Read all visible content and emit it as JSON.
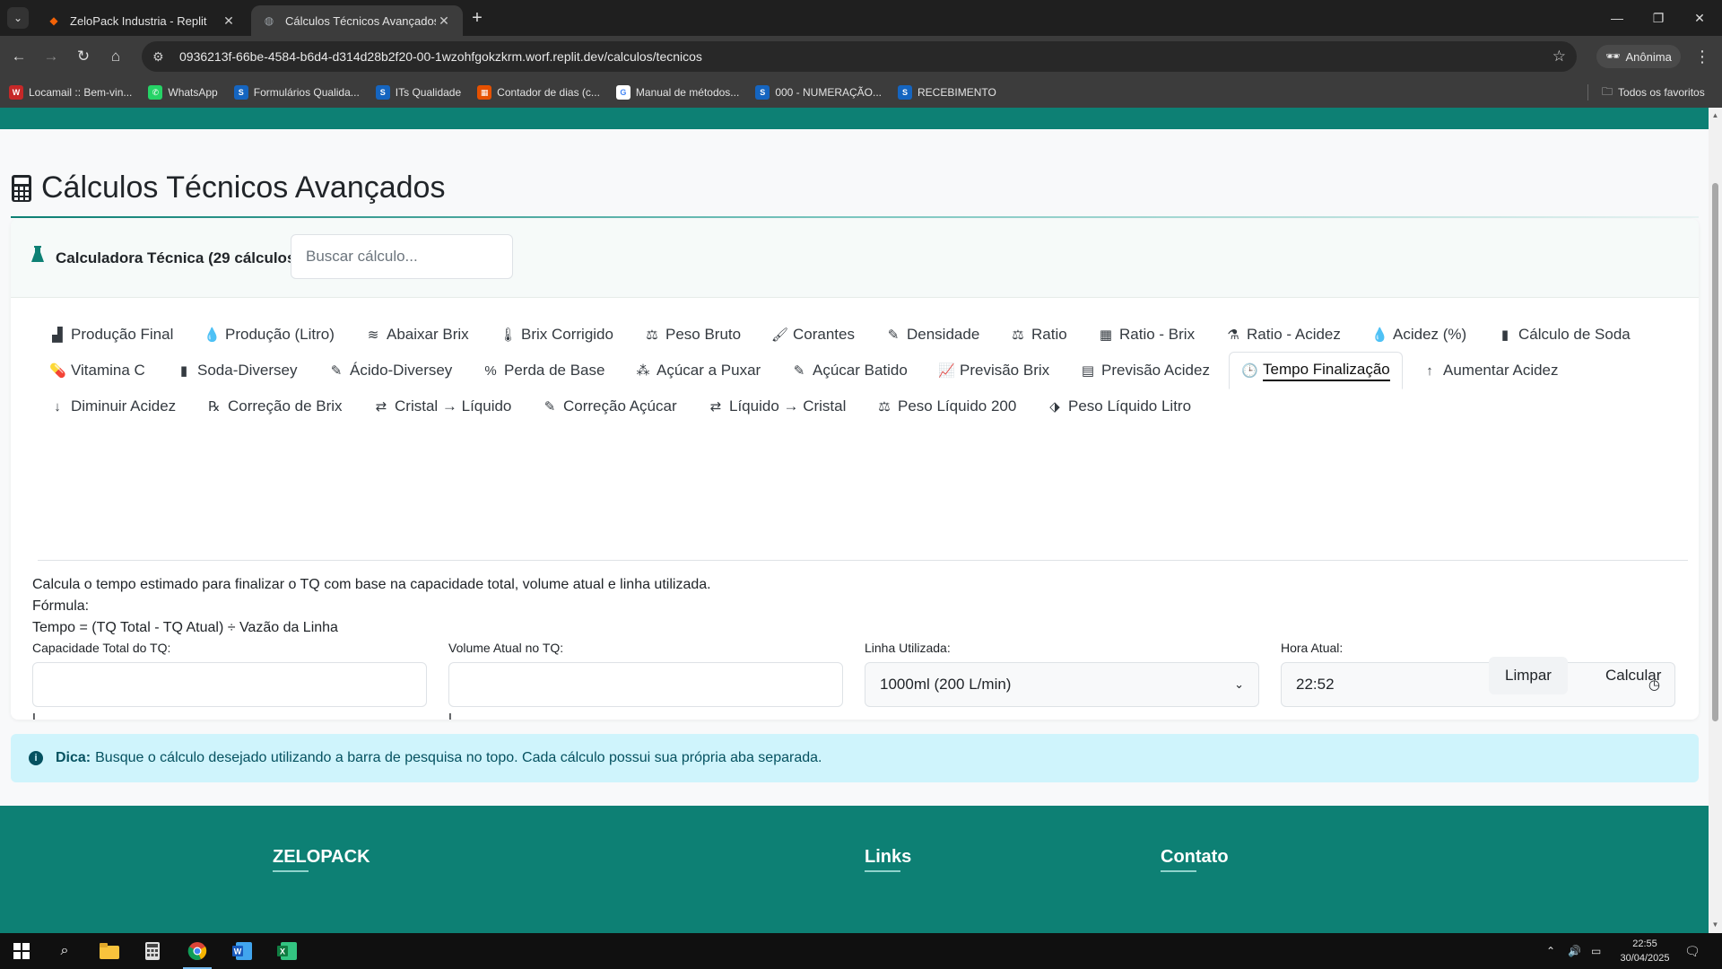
{
  "browser": {
    "tabs": [
      {
        "title": "ZeloPack Industria - Replit",
        "active": false
      },
      {
        "title": "Cálculos Técnicos Avançados - ZeloPack",
        "active": true
      }
    ],
    "url": "0936213f-66be-4584-b6d4-d314d28b2f20-00-1wzohfgokzkrm.worf.replit.dev/calculos/tecnicos",
    "profile_label": "Anônima",
    "bookmarks": [
      {
        "label": "Locamail :: Bem-vin...",
        "icon": "W",
        "color": "#c62828"
      },
      {
        "label": "WhatsApp",
        "icon": "✆",
        "color": "#25d366"
      },
      {
        "label": "Formulários Qualida...",
        "icon": "S",
        "color": "#1565c0"
      },
      {
        "label": "ITs Qualidade",
        "icon": "S",
        "color": "#1565c0"
      },
      {
        "label": "Contador de dias (c...",
        "icon": "▦",
        "color": "#e65100"
      },
      {
        "label": "Manual de métodos...",
        "icon": "G",
        "color": "#ffffff"
      },
      {
        "label": "000 - NUMERAÇÃO...",
        "icon": "S",
        "color": "#1565c0"
      },
      {
        "label": "RECEBIMENTO",
        "icon": "S",
        "color": "#1565c0"
      }
    ],
    "all_bookmarks_label": "Todos os favoritos"
  },
  "page": {
    "title": "Cálculos Técnicos Avançados",
    "card_label": "Calculadora Técnica (29 cálculos)",
    "search_placeholder": "Buscar cálculo...",
    "calc_tabs": [
      {
        "label": "Produção Final",
        "icon": "▟"
      },
      {
        "label": "Produção (Litro)",
        "icon": "💧"
      },
      {
        "label": "Abaixar Brix",
        "icon": "≋"
      },
      {
        "label": "Brix Corrigido",
        "icon": "🌡"
      },
      {
        "label": "Peso Bruto",
        "icon": "⚖"
      },
      {
        "label": "Corantes",
        "icon": "🖌"
      },
      {
        "label": "Densidade",
        "icon": "✎"
      },
      {
        "label": "Ratio",
        "icon": "⚖"
      },
      {
        "label": "Ratio - Brix",
        "icon": "▦"
      },
      {
        "label": "Ratio - Acidez",
        "icon": "⚗"
      },
      {
        "label": "Acidez (%)",
        "icon": "💧"
      },
      {
        "label": "Cálculo de Soda",
        "icon": "▮"
      },
      {
        "label": "Vitamina C",
        "icon": "💊"
      },
      {
        "label": "Soda-Diversey",
        "icon": "▮"
      },
      {
        "label": "Ácido-Diversey",
        "icon": "✎"
      },
      {
        "label": "Perda de Base",
        "icon": "%"
      },
      {
        "label": "Açúcar a Puxar",
        "icon": "⁂"
      },
      {
        "label": "Açúcar Batido",
        "icon": "✎"
      },
      {
        "label": "Previsão Brix",
        "icon": "📈"
      },
      {
        "label": "Previsão Acidez",
        "icon": "▤"
      },
      {
        "label": "Tempo Finalização",
        "icon": "🕒",
        "active": true
      },
      {
        "label": "Aumentar Acidez",
        "icon": "↑"
      },
      {
        "label": "Diminuir Acidez",
        "icon": "↓"
      },
      {
        "label": "Correção de Brix",
        "icon": "℞"
      },
      {
        "label": "Cristal → Líquido",
        "icon": "⇄"
      },
      {
        "label": "Correção Açúcar",
        "icon": "✎"
      },
      {
        "label": "Líquido → Cristal",
        "icon": "⇄"
      },
      {
        "label": "Peso Líquido 200",
        "icon": "⚖"
      },
      {
        "label": "Peso Líquido Litro",
        "icon": "⬗"
      }
    ],
    "description": "Calcula o tempo estimado para finalizar o TQ com base na capacidade total, volume atual e linha utilizada.",
    "formula_label": "Fórmula:",
    "formula": "Tempo = (TQ Total - TQ Atual) ÷ Vazão da Linha",
    "fields": {
      "capacity": {
        "label": "Capacidade Total do TQ:",
        "value": "",
        "unit": "L"
      },
      "volume": {
        "label": "Volume Atual no TQ:",
        "value": "",
        "unit": "L"
      },
      "line": {
        "label": "Linha Utilizada:",
        "value": "1000ml (200 L/min)"
      },
      "time": {
        "label": "Hora Atual:",
        "value": "22:52"
      }
    },
    "buttons": {
      "clear": "Limpar",
      "calculate": "Calcular"
    },
    "tip": {
      "bold": "Dica:",
      "text": "Busque o cálculo desejado utilizando a barra de pesquisa no topo. Cada cálculo possui sua própria aba separada."
    },
    "footer": {
      "brand": "ZELOPACK",
      "links": "Links",
      "contact": "Contato"
    }
  },
  "taskbar": {
    "time": "22:55",
    "date": "30/04/2025"
  }
}
